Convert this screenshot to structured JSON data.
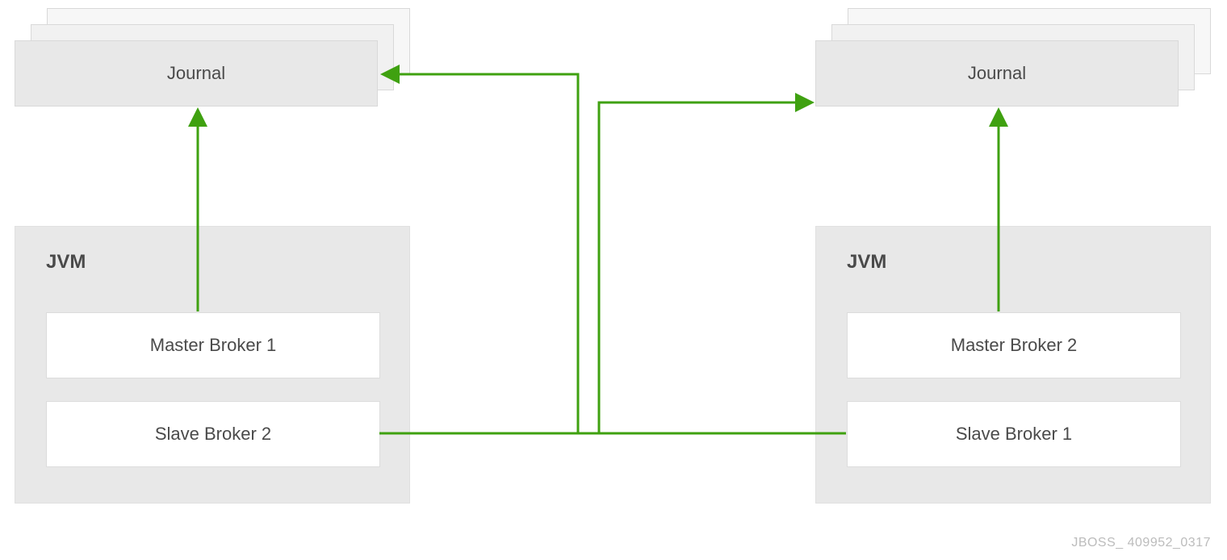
{
  "journal": {
    "left_label": "Journal",
    "right_label": "Journal"
  },
  "jvm": {
    "left": {
      "title": "JVM",
      "master": "Master Broker 1",
      "slave": "Slave Broker 2"
    },
    "right": {
      "title": "JVM",
      "master": "Master Broker 2",
      "slave": "Slave Broker 1"
    }
  },
  "footer": "JBOSS_ 409952_0317",
  "colors": {
    "arrow": "#3fa110",
    "box_bg": "#e8e8e8",
    "card_bg": "#ffffff",
    "text": "#4a4a4a"
  }
}
